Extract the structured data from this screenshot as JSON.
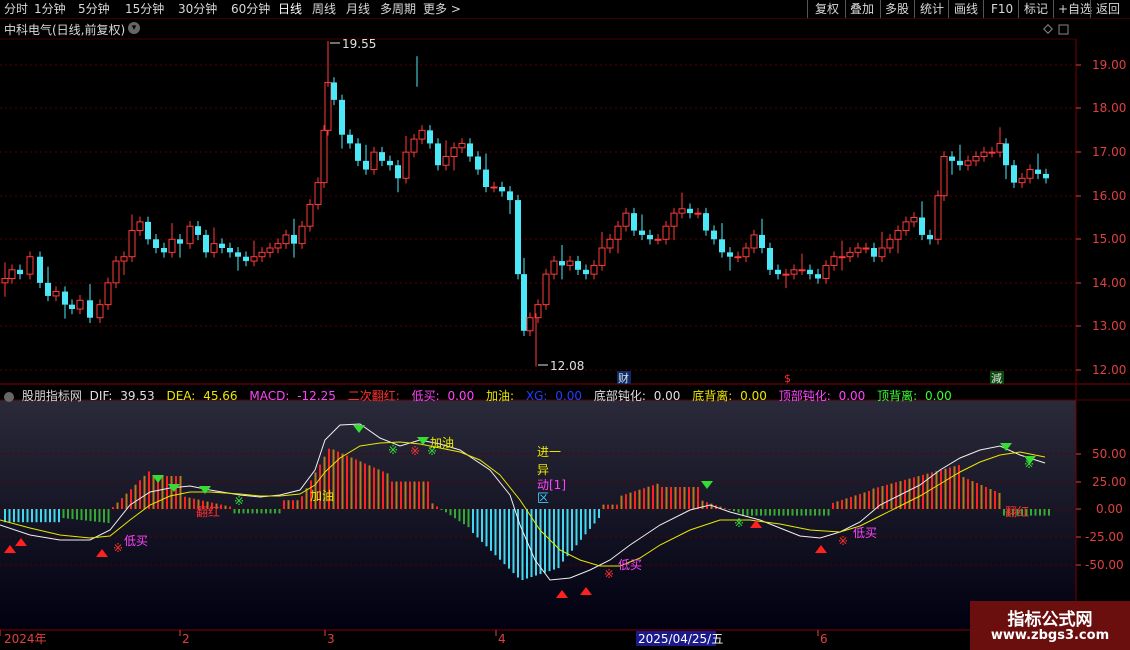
{
  "toolbar": {
    "periods": [
      "分时",
      "1分钟",
      "5分钟",
      "15分钟",
      "30分钟",
      "60分钟",
      "日线",
      "周线",
      "月线",
      "多周期",
      "更多 >"
    ],
    "active_period": "日线",
    "right_buttons": [
      "复权",
      "叠加",
      "多股",
      "统计",
      "画线",
      "F10",
      "标记",
      "+自选",
      "返回"
    ]
  },
  "stock": {
    "title": "中科电气(日线,前复权)",
    "arrow": "▾"
  },
  "price_axis": [
    "19.00",
    "18.00",
    "17.00",
    "16.00",
    "15.00",
    "14.00",
    "13.00",
    "12.00"
  ],
  "price_marks": {
    "high": "19.55",
    "low": "12.08"
  },
  "event_markers": [
    "财",
    "$",
    "減"
  ],
  "macd": {
    "title": "股朋指标网",
    "items": [
      {
        "label": "DIF:",
        "value": "39.53",
        "color": "#e0e0e0"
      },
      {
        "label": "DEA:",
        "value": "45.66",
        "color": "#e8e800"
      },
      {
        "label": "MACD:",
        "value": "-12.25",
        "color": "#ff44ff"
      },
      {
        "label": "二次翻红:",
        "value": "",
        "color": "#ff3030"
      },
      {
        "label": "低买:",
        "value": "0.00",
        "color": "#ff44ff"
      },
      {
        "label": "加油:",
        "value": "",
        "color": "#e8e800"
      },
      {
        "label": "XG:",
        "value": "0.00",
        "color": "#2040ff"
      },
      {
        "label": "底部钝化:",
        "value": "0.00",
        "color": "#e0e0e0"
      },
      {
        "label": "底背离:",
        "value": "0.00",
        "color": "#e8e800"
      },
      {
        "label": "顶部钝化:",
        "value": "0.00",
        "color": "#ff44ff"
      },
      {
        "label": "顶背离:",
        "value": "0.00",
        "color": "#33ff33"
      }
    ],
    "axis": [
      "50.00",
      "25.00",
      "0.00",
      "-25.00",
      "-50.00"
    ],
    "annotations": {
      "fanhong": "翻红",
      "dimai": "低买",
      "jiayou": "加油",
      "jinyi": "进一",
      "yi": "异",
      "dong": "动[1]",
      "qu": "区"
    }
  },
  "date_axis": [
    "2024年",
    "2",
    "3",
    "4",
    "2025/04/25/五",
    "6"
  ],
  "watermark": {
    "title": "指标公式网",
    "url": "www.zbgs3.com"
  }
}
